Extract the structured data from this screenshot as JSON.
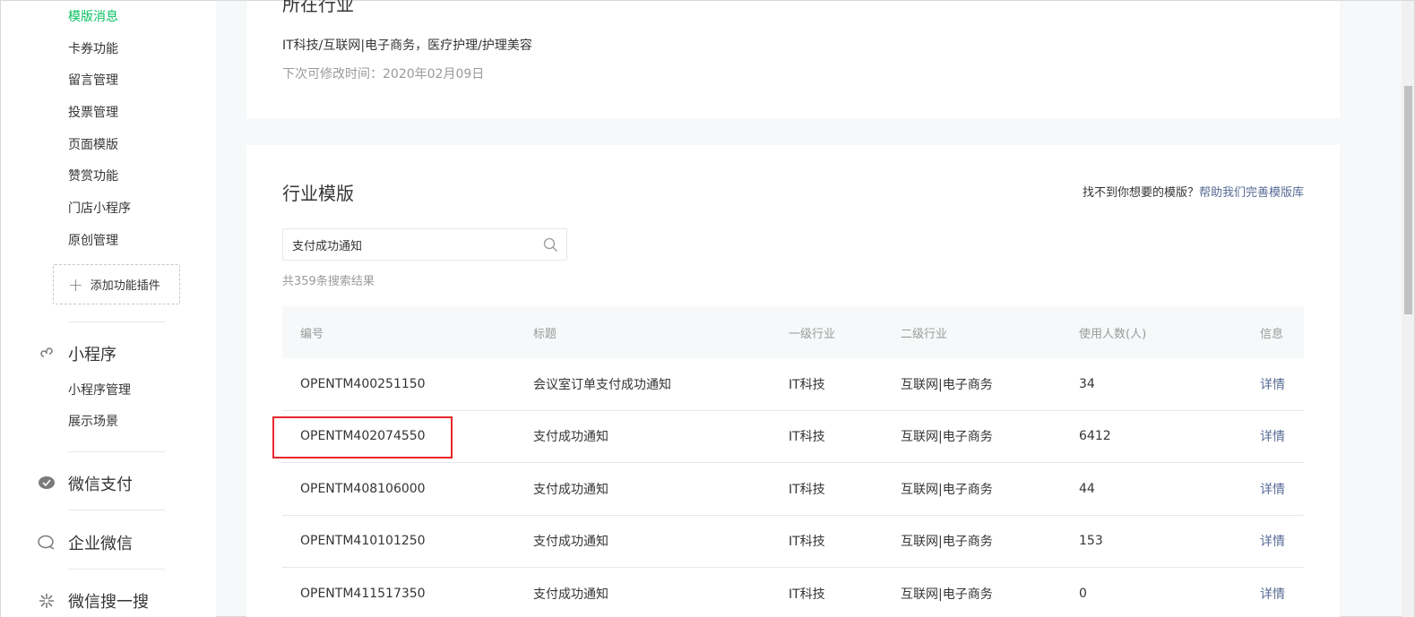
{
  "sidebar": {
    "items": [
      {
        "label": "模版消息",
        "active": true
      },
      {
        "label": "卡券功能"
      },
      {
        "label": "留言管理"
      },
      {
        "label": "投票管理"
      },
      {
        "label": "页面模版"
      },
      {
        "label": "赞赏功能"
      },
      {
        "label": "门店小程序"
      },
      {
        "label": "原创管理"
      }
    ],
    "add_plugin": "添加功能插件",
    "sections": [
      {
        "label": "小程序",
        "icon": "link-icon"
      },
      {
        "label": "微信支付",
        "icon": "wechat-pay-icon"
      },
      {
        "label": "企业微信",
        "icon": "work-wechat-icon"
      },
      {
        "label": "微信搜一搜",
        "icon": "search-star-icon"
      }
    ],
    "mini_program_items": [
      {
        "label": "小程序管理"
      },
      {
        "label": "展示场景"
      }
    ]
  },
  "industry_card": {
    "title": "所在行业",
    "industry": "IT科技/互联网|电子商务，医疗护理/护理美容",
    "next_modify": "下次可修改时间：2020年02月09日"
  },
  "templates": {
    "title": "行业模版",
    "help_prefix": "找不到你想要的模版？",
    "help_link": "帮助我们完善模版库",
    "search_value": "支付成功通知",
    "result_count": "共359条搜索结果",
    "columns": [
      "编号",
      "标题",
      "一级行业",
      "二级行业",
      "使用人数(人)",
      "信息"
    ],
    "rows": [
      {
        "id": "OPENTM400251150",
        "title": "会议室订单支付成功通知",
        "primary": "IT科技",
        "secondary": "互联网|电子商务",
        "users": "34",
        "info": "详情"
      },
      {
        "id": "OPENTM402074550",
        "title": "支付成功通知",
        "primary": "IT科技",
        "secondary": "互联网|电子商务",
        "users": "6412",
        "info": "详情"
      },
      {
        "id": "OPENTM408106000",
        "title": "支付成功通知",
        "primary": "IT科技",
        "secondary": "互联网|电子商务",
        "users": "44",
        "info": "详情"
      },
      {
        "id": "OPENTM410101250",
        "title": "支付成功通知",
        "primary": "IT科技",
        "secondary": "互联网|电子商务",
        "users": "153",
        "info": "详情"
      },
      {
        "id": "OPENTM411517350",
        "title": "支付成功通知",
        "primary": "IT科技",
        "secondary": "互联网|电子商务",
        "users": "0",
        "info": "详情"
      }
    ]
  },
  "colors": {
    "active": "#07c160",
    "link": "#576b95",
    "highlight": "#e8282b"
  }
}
